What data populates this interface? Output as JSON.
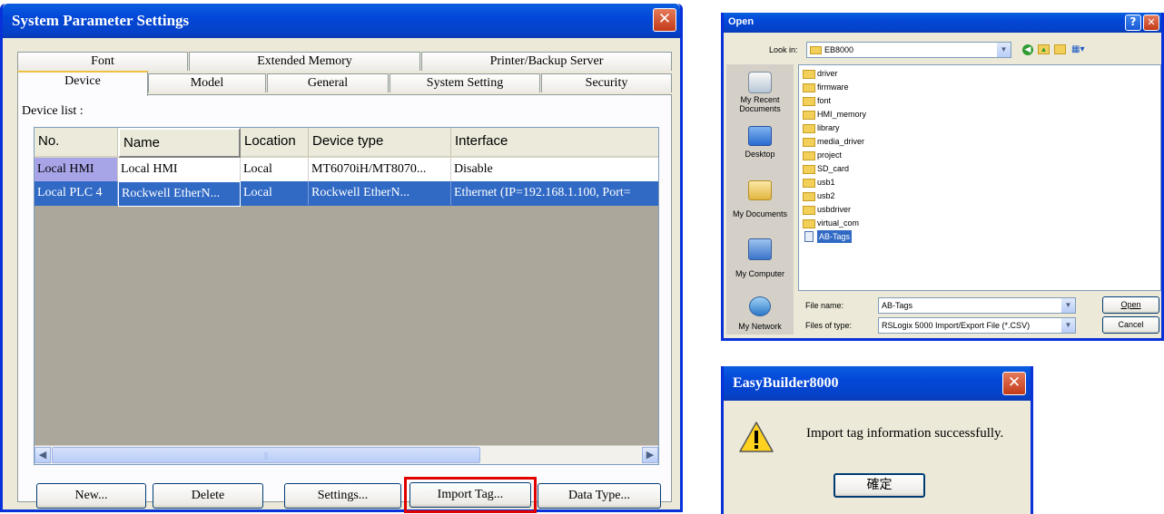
{
  "sys": {
    "title": "System Parameter Settings",
    "tabs_row1": [
      "Font",
      "Extended Memory",
      "Printer/Backup Server"
    ],
    "tabs_row2": [
      "Device",
      "Model",
      "General",
      "System Setting",
      "Security"
    ],
    "device_list_label": "Device list :",
    "columns": [
      "No.",
      "Name",
      "Location",
      "Device type",
      "Interface"
    ],
    "rows": [
      [
        "Local HMI",
        "Local HMI",
        "Local",
        "MT6070iH/MT8070...",
        "Disable"
      ],
      [
        "Local PLC 4",
        "Rockwell EtherN...",
        "Local",
        "Rockwell EtherN...",
        "Ethernet (IP=192.168.1.100, Port="
      ]
    ],
    "buttons": [
      "New...",
      "Delete",
      "Settings...",
      "Import Tag...",
      "Data Type..."
    ],
    "highlight_color": "#e00000",
    "selected_row_color": "#316ac5"
  },
  "open": {
    "title": "Open",
    "look_in_label": "Look in:",
    "look_in_value": "EB8000",
    "places": [
      "My Recent Documents",
      "Desktop",
      "My Documents",
      "My Computer",
      "My Network"
    ],
    "folders": [
      "driver",
      "firmware",
      "font",
      "HMI_memory",
      "library",
      "media_driver",
      "project",
      "SD_card",
      "usb1",
      "usb2",
      "usbdriver",
      "virtual_com"
    ],
    "selected_file": "AB-Tags",
    "file_name_label": "File name:",
    "file_name_value": "AB-Tags",
    "files_of_type_label": "Files of type:",
    "files_of_type_value": "RSLogix 5000 Import/Export File (*.CSV)",
    "open_button": "Open",
    "cancel_button": "Cancel"
  },
  "msg": {
    "title": "EasyBuilder8000",
    "text": "Import tag information successfully.",
    "ok_button": "確定"
  }
}
